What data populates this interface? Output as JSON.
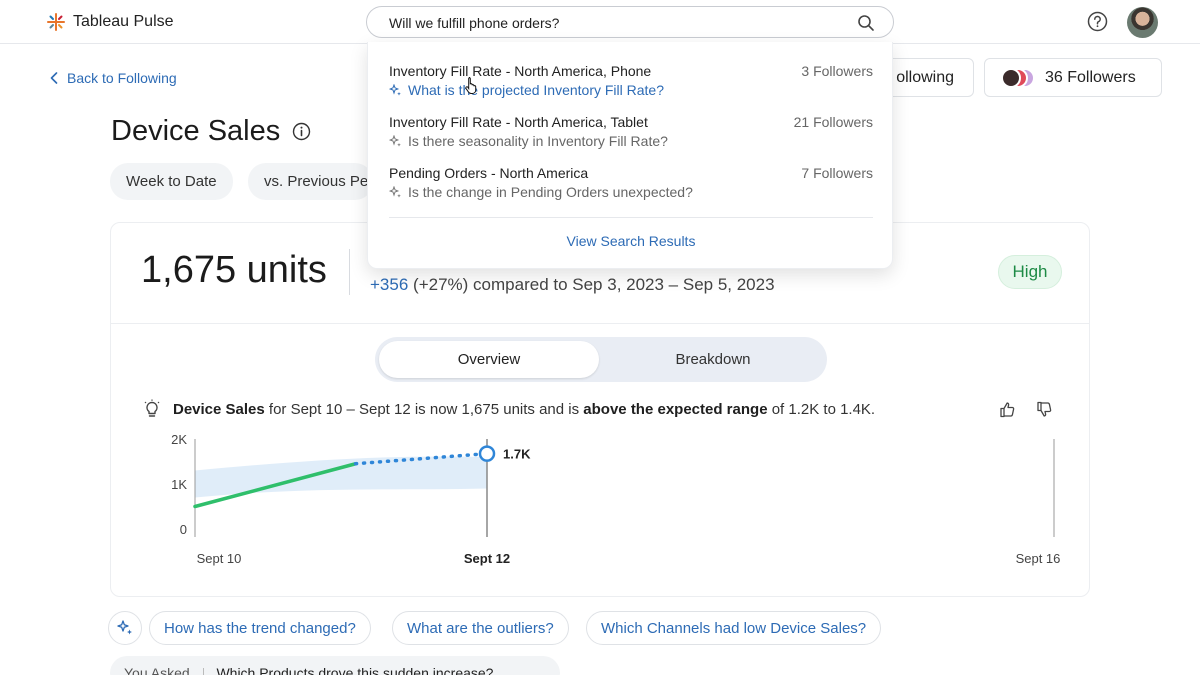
{
  "app": {
    "name": "Tableau Pulse"
  },
  "search": {
    "value": "Will we fulfill phone orders?",
    "placeholder": ""
  },
  "nav": {
    "back_label": "Back to Following"
  },
  "header": {
    "following_label": "ollowing",
    "followers_label": "36 Followers"
  },
  "page": {
    "title": "Device Sales"
  },
  "filters": {
    "date_range": "Week to Date",
    "comparison": "vs. Previous Pe"
  },
  "metric": {
    "value": "1,675 units",
    "delta": "+356",
    "delta_pct": "(+27%)",
    "compare_text": "compared to Sep 3, 2023 – Sep 5, 2023",
    "badge": "High"
  },
  "tabs": [
    {
      "label": "Overview",
      "active": true
    },
    {
      "label": "Breakdown",
      "active": false
    }
  ],
  "insight": {
    "bold1": "Device Sales",
    "text1": " for Sept 10 – Sept 12 is now 1,675 units and is ",
    "bold2": "above the expected range",
    "text2": " of 1.2K to 1.4K."
  },
  "chart_data": {
    "type": "line",
    "x_labels": [
      "Sept 10",
      "Sept 12",
      "Sept 16"
    ],
    "y_ticks": [
      "2K",
      "1K",
      "0"
    ],
    "ylim": [
      0,
      2000
    ],
    "series": [
      {
        "style": "solid",
        "color": "#2fbf6b",
        "points": [
          [
            0,
            500
          ],
          [
            1.1,
            1450
          ]
        ]
      },
      {
        "style": "dotted",
        "color": "#2f86d8",
        "points": [
          [
            1.1,
            1450
          ],
          [
            2,
            1675
          ]
        ]
      }
    ],
    "expected_range": {
      "low": 1200,
      "high": 1400
    },
    "current_label": "1.7K",
    "colors": {
      "actual": "#2fbf6b",
      "projection": "#2f86d8",
      "band": "#dbeaf8"
    }
  },
  "suggestions": [
    "How has the trend changed?",
    "What are the outliers?",
    "Which Channels had low Device Sales?"
  ],
  "asked": {
    "prefix": "You Asked",
    "question": "Which Products drove this sudden increase?"
  },
  "dropdown": {
    "items": [
      {
        "title": "Inventory Fill Rate - North America, Phone",
        "count": "3 Followers",
        "question": "What is the projected Inventory Fill Rate?"
      },
      {
        "title": "Inventory Fill Rate - North America, Tablet",
        "count": "21 Followers",
        "question": "Is there seasonality in Inventory Fill Rate?"
      },
      {
        "title": "Pending Orders - North America",
        "count": "7 Followers",
        "question": "Is the change in Pending Orders unexpected?"
      }
    ],
    "view_all": "View Search Results"
  }
}
